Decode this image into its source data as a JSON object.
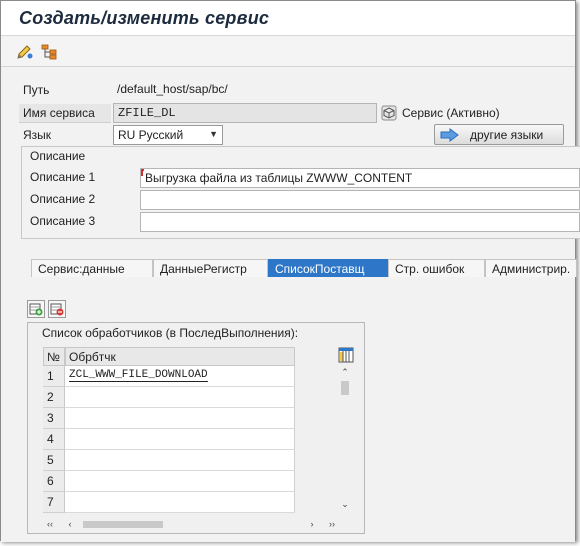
{
  "title": "Создать/изменить сервис",
  "toolbar": {
    "buttons": [
      {
        "icon": "edit-pencil-icon"
      },
      {
        "icon": "hierarchy-icon"
      }
    ]
  },
  "form": {
    "path_label": "Путь",
    "path_value": "/default_host/sap/bc/",
    "service_name_label": "Имя сервиса",
    "service_name_value": "ZFILE_DL",
    "service_status": "Сервис (Активно)",
    "language_label": "Язык",
    "language_value": "RU Русский",
    "other_languages_button": "другие языки"
  },
  "description": {
    "group_title": "Описание",
    "rows": [
      {
        "label": "Описание 1",
        "value": "Выгрузка файла из таблицы ZWWW_CONTENT"
      },
      {
        "label": "Описание 2",
        "value": ""
      },
      {
        "label": "Описание 3",
        "value": ""
      }
    ]
  },
  "tabs": [
    {
      "label": "Сервис:данные",
      "active": false
    },
    {
      "label": "ДанныеРегистр",
      "active": false
    },
    {
      "label": "СписокПоставщ",
      "active": true
    },
    {
      "label": "Стр. ошибок",
      "active": false
    },
    {
      "label": "Администрир.",
      "active": false
    }
  ],
  "handler_table": {
    "caption": "Список обработчиков (в ПоследВыполнения):",
    "columns": [
      "№",
      "Обрбтчк"
    ],
    "rows": [
      {
        "n": "1",
        "handler": "ZCL_WWW_FILE_DOWNLOAD"
      },
      {
        "n": "2",
        "handler": ""
      },
      {
        "n": "3",
        "handler": ""
      },
      {
        "n": "4",
        "handler": ""
      },
      {
        "n": "5",
        "handler": ""
      },
      {
        "n": "6",
        "handler": ""
      },
      {
        "n": "7",
        "handler": ""
      }
    ]
  },
  "colors": {
    "active_tab": "#2d76c8",
    "title_text": "#1c2b3d",
    "button_arrow": "#2a6ebd"
  }
}
